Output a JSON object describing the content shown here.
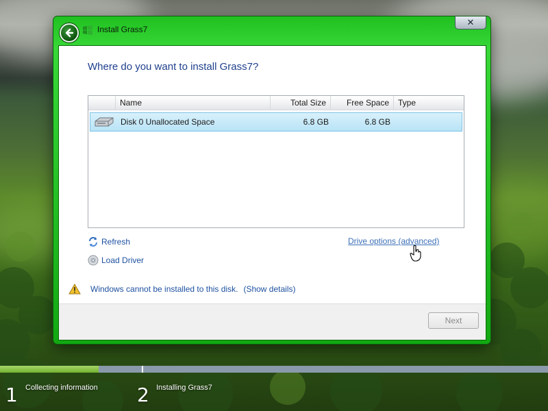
{
  "window": {
    "title": "Install Grass7",
    "close_glyph": "✕"
  },
  "main": {
    "heading": "Where do you want to install Grass7?",
    "table": {
      "columns": [
        "Name",
        "Total Size",
        "Free Space",
        "Type"
      ],
      "rows": [
        {
          "name": "Disk 0 Unallocated Space",
          "total_size": "6.8 GB",
          "free_space": "6.8 GB",
          "type": "",
          "selected": true
        }
      ]
    },
    "links": {
      "refresh": "Refresh",
      "load_driver": "Load Driver",
      "drive_options": "Drive options (advanced)"
    },
    "warning": {
      "message": "Windows cannot be installed to this disk.",
      "details": "(Show details)"
    },
    "next_button": "Next"
  },
  "progress": {
    "completed_fraction": 0.18,
    "steps": [
      {
        "number": "1",
        "label": "Collecting information"
      },
      {
        "number": "2",
        "label": "Installing Grass7"
      }
    ]
  },
  "icons": {
    "back": "back-arrow-icon",
    "app": "windows-flag-icon",
    "refresh": "refresh-icon",
    "load_driver": "disc-icon",
    "warning": "warning-icon",
    "disk": "hard-disk-icon",
    "cursor": "hand-cursor-icon"
  },
  "colors": {
    "window_frame": "#20c020",
    "heading": "#1e3f8c",
    "link": "#1e50a0",
    "selection": "#b8e3f6",
    "progress_fill": "#73b22e",
    "progress_track": "#8a9aab"
  }
}
